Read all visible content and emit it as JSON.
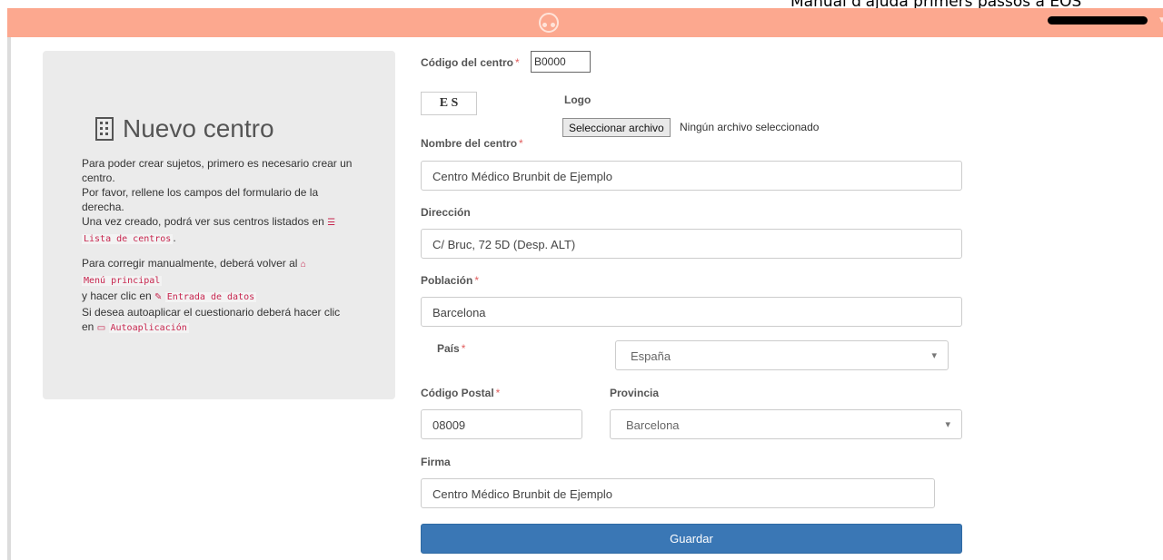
{
  "caption": "Manual d'ajuda primers passos a EOS",
  "header": {
    "brand_color": "#fca88f",
    "user_menu_icon": "chevron-down-icon"
  },
  "panel": {
    "icon": "building-icon",
    "title": "Nuevo centro",
    "p1_a": "Para poder crear sujetos, primero es necesario crear un centro.",
    "p1_b": "Por favor, rellene los campos del formulario de la derecha.",
    "p1_c": "Una vez creado, podrá ver sus centros listados en",
    "link_list": "Lista de centros",
    "p2_a": "Para corregir manualmente, deberá volver al",
    "link_menu": "Menú principal",
    "p2_b": "y hacer clic en",
    "link_entry": "Entrada de datos",
    "p2_c": "Si desea autoaplicar el cuestionario deberá hacer clic en",
    "link_auto": "Autoaplicación"
  },
  "form": {
    "code_label": "Código del centro",
    "code_value": "B0000",
    "logo_label": "Logo",
    "logo_text": "E S",
    "file_button": "Seleccionar archivo",
    "file_status": "Ningún archivo seleccionado",
    "name_label": "Nombre del centro",
    "name_value": "Centro Médico Brunbit de Ejemplo",
    "address_label": "Dirección",
    "address_value": "C/ Bruc, 72 5D (Desp. ALT)",
    "city_label": "Población",
    "city_value": "Barcelona",
    "country_label": "País",
    "country_value": "España",
    "postal_label": "Código Postal",
    "postal_value": "08009",
    "province_label": "Provincia",
    "province_value": "Barcelona",
    "signature_label": "Firma",
    "signature_value": "Centro Médico Brunbit de Ejemplo",
    "required_mark": "*",
    "save_button": "Guardar"
  }
}
